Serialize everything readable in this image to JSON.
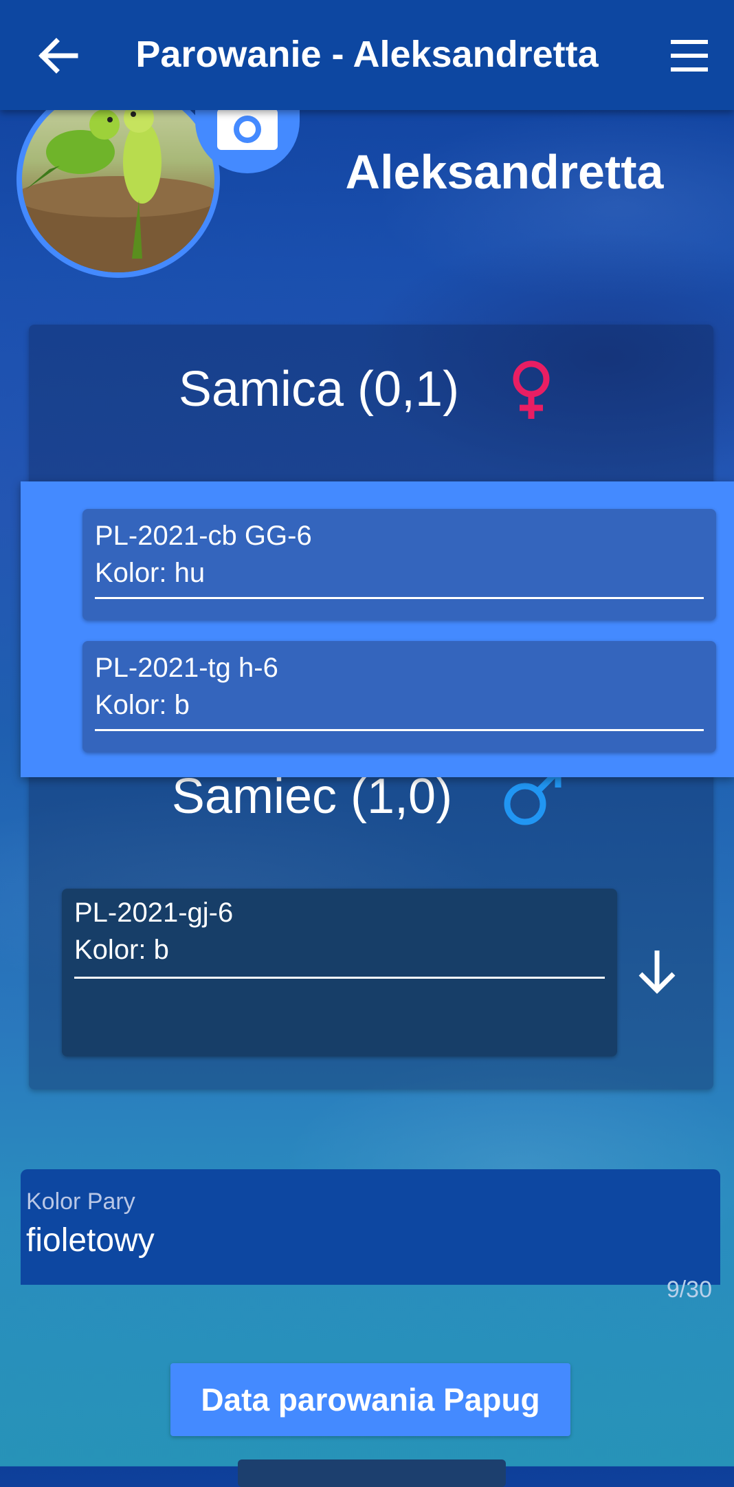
{
  "header": {
    "title": "Parowanie - Aleksandretta",
    "back_icon": "arrow-left-icon",
    "menu_icon": "hamburger-menu-icon"
  },
  "profile": {
    "name": "Aleksandretta",
    "photo_icon": "camera-icon"
  },
  "female": {
    "title": "Samica (0,1)",
    "symbol_icon": "female-symbol-icon",
    "symbol_color": "#e91e63",
    "options": [
      {
        "id": "PL-2021-cb GG-6",
        "color": "Kolor: hu"
      },
      {
        "id": "PL-2021-tg h-6",
        "color": "Kolor: b"
      }
    ]
  },
  "male": {
    "title": "Samiec (1,0)",
    "symbol_icon": "male-symbol-icon",
    "symbol_color": "#2196f3",
    "selected": {
      "id": "PL-2021-gj-6",
      "color": "Kolor: b"
    },
    "expand_icon": "arrow-down-icon"
  },
  "pair_color": {
    "label": "Kolor Pary",
    "value": "fioletowy",
    "counter": "9/30"
  },
  "buttons": {
    "pairing_date": "Data parowania Papug"
  },
  "colors": {
    "accent": "#448aff",
    "appbar": "#0d47a1"
  }
}
